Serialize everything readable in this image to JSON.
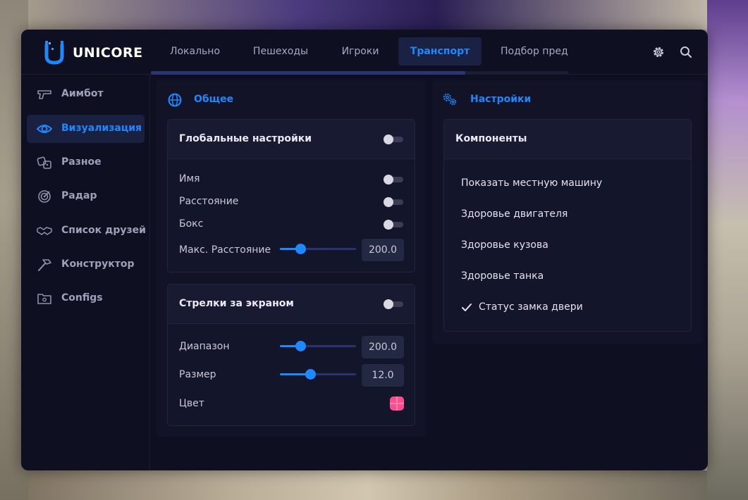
{
  "app": {
    "brand": "UNICORE",
    "accent_color": "#1e88ff"
  },
  "header": {
    "tabs": [
      {
        "label": "Локально",
        "active": false
      },
      {
        "label": "Пешеходы",
        "active": false
      },
      {
        "label": "Игроки",
        "active": false
      },
      {
        "label": "Транспорт",
        "active": true
      },
      {
        "label": "Подбор пред",
        "active": false
      }
    ],
    "icons": [
      "gear-icon",
      "search-icon"
    ]
  },
  "sidebar": {
    "items": [
      {
        "label": "Аимбот",
        "icon": "gun-icon",
        "active": false
      },
      {
        "label": "Визуализация",
        "icon": "eye-icon",
        "active": true
      },
      {
        "label": "Разное",
        "icon": "dice-icon",
        "active": false
      },
      {
        "label": "Радар",
        "icon": "radar-icon",
        "active": false
      },
      {
        "label": "Список друзей",
        "icon": "handshake-icon",
        "active": false
      },
      {
        "label": "Конструктор",
        "icon": "hammer-icon",
        "active": false
      },
      {
        "label": "Configs",
        "icon": "folder-icon",
        "active": false
      }
    ]
  },
  "general": {
    "title": "Общее",
    "global": {
      "title": "Глобальные настройки",
      "enabled": false,
      "rows": [
        {
          "label": "Имя",
          "enabled": false
        },
        {
          "label": "Расстояние",
          "enabled": false
        },
        {
          "label": "Бокс",
          "enabled": false
        }
      ],
      "max_distance": {
        "label": "Макс. Расстояние",
        "value": "200.0",
        "fraction": 0.24
      }
    },
    "offscreen": {
      "title": "Стрелки за экраном",
      "enabled": false,
      "range": {
        "label": "Диапазон",
        "value": "200.0",
        "fraction": 0.24
      },
      "size": {
        "label": "Размер",
        "value": "12.0",
        "fraction": 0.39
      },
      "color": {
        "label": "Цвет",
        "value": "#ff4d8d"
      }
    }
  },
  "settings": {
    "title": "Настройки",
    "components": {
      "title": "Компоненты",
      "items": [
        {
          "label": "Показать местную машину",
          "checked": false
        },
        {
          "label": "Здоровье двигателя",
          "checked": false
        },
        {
          "label": "Здоровье кузова",
          "checked": false
        },
        {
          "label": "Здоровье танка",
          "checked": false
        },
        {
          "label": "Статус замка двери",
          "checked": true
        }
      ]
    }
  }
}
